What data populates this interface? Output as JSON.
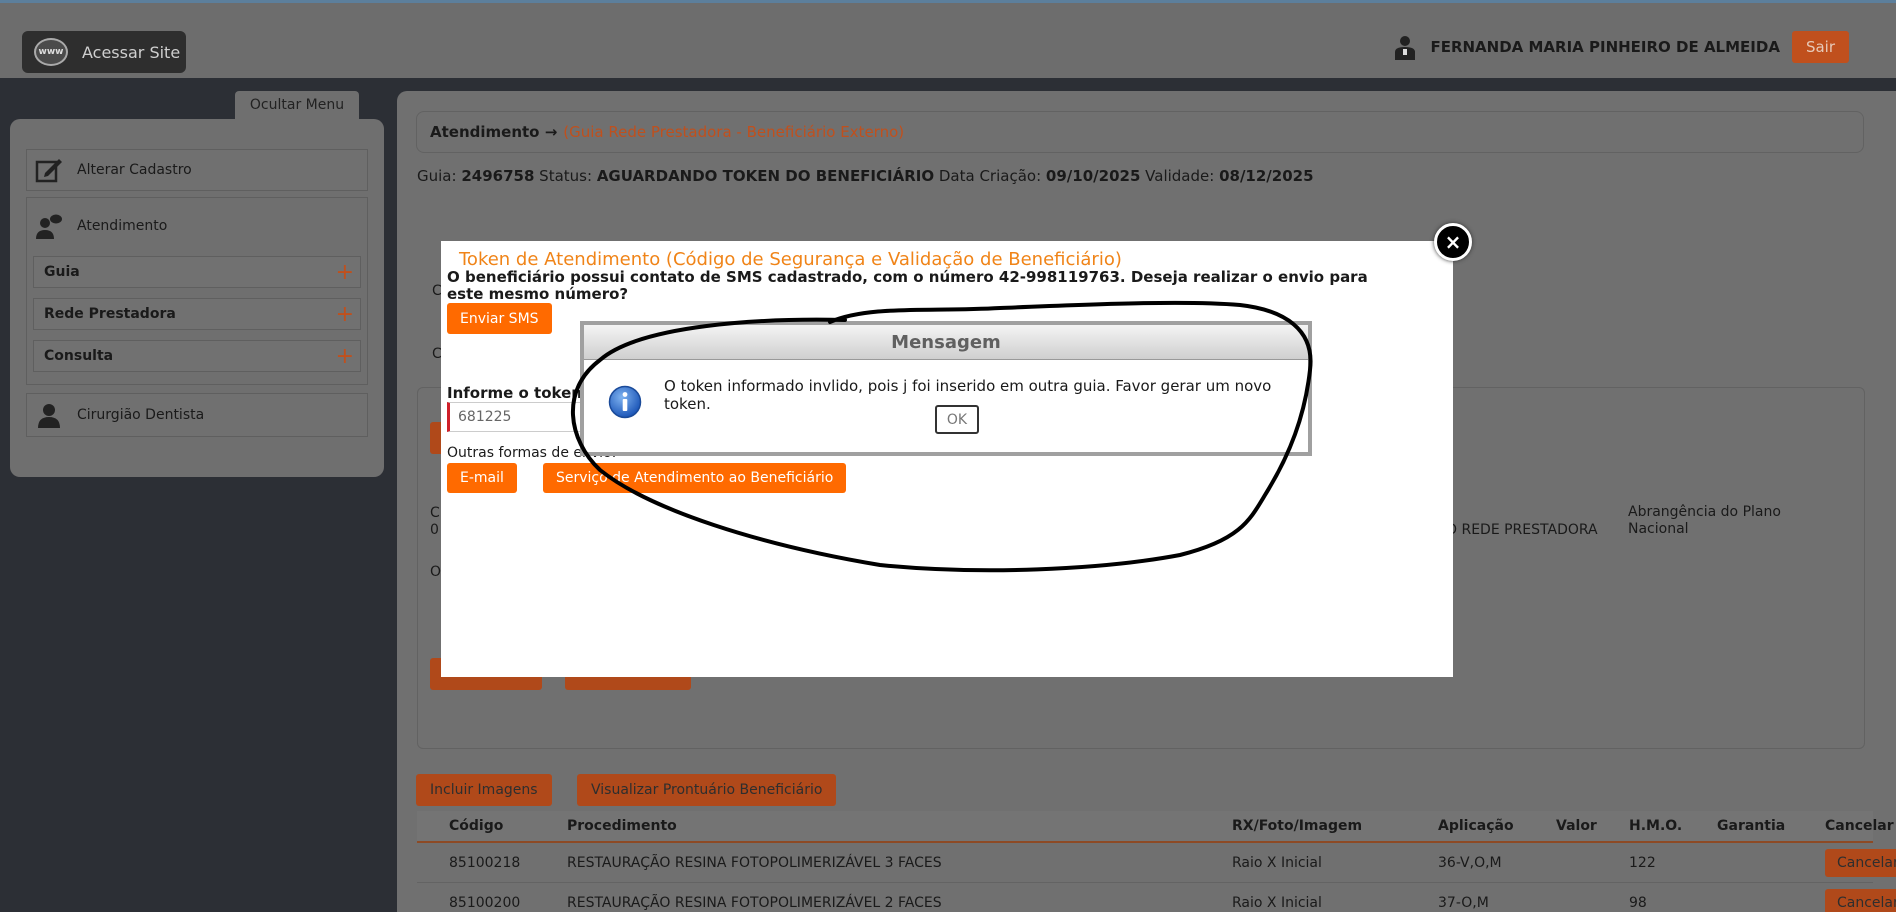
{
  "header": {
    "site_button": "Acessar Site",
    "www_label": "www",
    "user_name": "FERNANDA MARIA PINHEIRO DE ALMEIDA",
    "logout": "Sair"
  },
  "sidebar": {
    "hide_menu": "Ocultar Menu",
    "edit_profile": "Alterar Cadastro",
    "attendance": "Atendimento",
    "submenu": [
      {
        "label": "Guia"
      },
      {
        "label": "Rede Prestadora"
      },
      {
        "label": "Consulta"
      }
    ],
    "dentist": "Cirurgião Dentista"
  },
  "main": {
    "breadcrumb": {
      "root": "Atendimento →",
      "current": "(Guia Rede Prestadora - Beneficiário Externo)"
    },
    "info": {
      "guia_label": "Guia:",
      "guia_value": "2496758",
      "status_label": "Status:",
      "status_value": "AGUARDANDO TOKEN DO BENEFICIÁRIO",
      "created_label": "Data Criação:",
      "created_value": "09/10/2025",
      "validity_label": "Validade:",
      "validity_value": "08/12/2025"
    },
    "bg_partials": {
      "c1": "C",
      "c2": "C",
      "c3": "C",
      "c3b": "0",
      "c4": "O",
      "rede": "O REDE PRESTADORA",
      "scope_label": "Abrangência do Plano",
      "scope_value": "Nacional"
    },
    "buttons": {
      "include_images": "Incluir Imagens",
      "view_record": "Visualizar Prontuário Beneficiário"
    },
    "table": {
      "headers": [
        "Código",
        "Procedimento",
        "RX/Foto/Imagem",
        "Aplicação",
        "Valor",
        "H.M.O.",
        "Garantia",
        "Cancelar"
      ],
      "rows": [
        {
          "code": "85100218",
          "procedure": "RESTAURAÇÃO RESINA FOTOPOLIMERIZÁVEL 3 FACES",
          "rx": "Raio X Inicial",
          "application": "36-V,O,M",
          "value": "",
          "hmo": "122",
          "warranty": "",
          "cancel": "Cancelar"
        },
        {
          "code": "85100200",
          "procedure": "RESTAURAÇÃO RESINA FOTOPOLIMERIZÁVEL 2 FACES",
          "rx": "Raio X Inicial",
          "application": "37-O,M",
          "value": "",
          "hmo": "98",
          "warranty": "",
          "cancel": "Cancelar"
        }
      ]
    }
  },
  "modal": {
    "title": "Token de Atendimento (Código de Segurança e Validação de Beneficiário)",
    "text": "O beneficiário possui contato de SMS cadastrado, com o número 42-998119763. Deseja realizar o envio para este mesmo número?",
    "send_sms": "Enviar SMS",
    "token_label": "Informe o token d",
    "token_value": "681225",
    "other_label": "Outras formas de envio:",
    "email": "E-mail",
    "service": "Serviço de Atendimento ao Beneficiário",
    "close": "×"
  },
  "message": {
    "title": "Mensagem",
    "text": "O token informado invlido, pois j foi inserido em outra guia. Favor gerar um novo token.",
    "ok": "OK"
  },
  "colors": {
    "accent": "#ff6a00",
    "title_orange": "#f08418",
    "overlay_dark": "#2c2f35"
  }
}
